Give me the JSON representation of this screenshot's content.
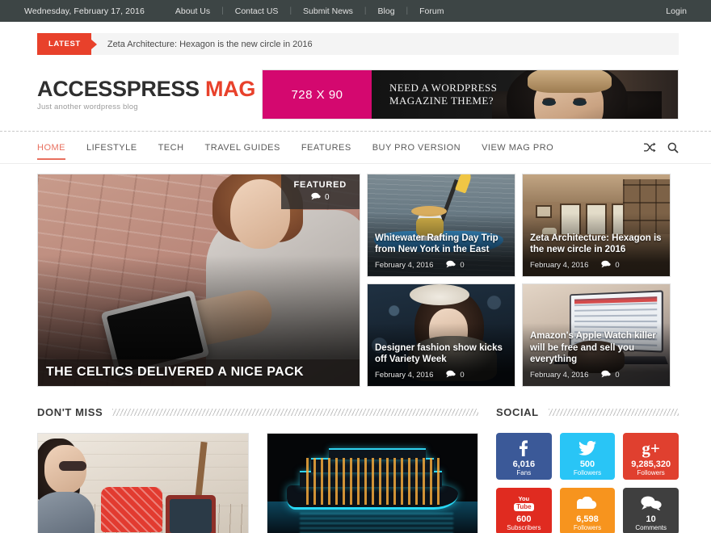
{
  "topbar": {
    "date": "Wednesday, February 17, 2016",
    "links": [
      "About Us",
      "Contact US",
      "Submit News",
      "Blog",
      "Forum"
    ],
    "separator": "|",
    "login": "Login"
  },
  "ticker": {
    "badge": "LATEST",
    "headline": "Zeta Architecture: Hexagon is the new circle in 2016"
  },
  "branding": {
    "logo_first": "ACCESSPRESS",
    "logo_second": "MAG",
    "tagline": "Just another wordpress blog",
    "logo_accent_color": "#e8412b"
  },
  "ad": {
    "size_label": "728 X 90",
    "headline_line1": "NEED A WORDPRESS",
    "headline_line2": "MAGAZINE THEME?",
    "left_color": "#d4086f"
  },
  "nav": {
    "items": [
      {
        "label": "HOME",
        "active": true
      },
      {
        "label": "LIFESTYLE",
        "active": false
      },
      {
        "label": "TECH",
        "active": false
      },
      {
        "label": "TRAVEL GUIDES",
        "active": false
      },
      {
        "label": "FEATURES",
        "active": false
      },
      {
        "label": "BUY PRO VERSION",
        "active": false
      },
      {
        "label": "VIEW MAG PRO",
        "active": false
      }
    ],
    "icons": [
      "shuffle-icon",
      "search-icon"
    ],
    "active_color": "#e8705f"
  },
  "featured": {
    "tag_label": "FEATURED",
    "tag_comments": "0",
    "main": {
      "title": "THE CELTICS DELIVERED A NICE PACK"
    },
    "cards": [
      {
        "title": "Whitewater Rafting Day Trip from New York in the East",
        "date": "February 4, 2016",
        "comments": "0"
      },
      {
        "title": "Zeta Architecture: Hexagon is the new circle in 2016",
        "date": "February 4, 2016",
        "comments": "0"
      },
      {
        "title": "Designer fashion show kicks off Variety Week",
        "date": "February 4, 2016",
        "comments": "0"
      },
      {
        "title": "Amazon's Apple Watch killer will be free and sell you everything",
        "date": "February 4, 2016",
        "comments": "0"
      }
    ]
  },
  "dont_miss": {
    "heading": "DON'T MISS"
  },
  "social": {
    "heading": "SOCIAL",
    "tiles": [
      {
        "network": "facebook",
        "icon": "facebook-icon",
        "count": "6,016",
        "label": "Fans",
        "color": "#3b5998"
      },
      {
        "network": "twitter",
        "icon": "twitter-icon",
        "count": "500",
        "label": "Followers",
        "color": "#29c5f6"
      },
      {
        "network": "googleplus",
        "icon": "google-plus-icon",
        "count": "9,285,320",
        "label": "Followers",
        "color": "#e0402f"
      },
      {
        "network": "youtube",
        "icon": "youtube-icon",
        "count": "600",
        "label": "Subscribers",
        "color": "#e02b20"
      },
      {
        "network": "soundcloud",
        "icon": "soundcloud-icon",
        "count": "6,598",
        "label": "Followers",
        "color": "#f7941e"
      },
      {
        "network": "comments",
        "icon": "comments-icon",
        "count": "10",
        "label": "Comments",
        "color": "#3f3f3f"
      }
    ]
  }
}
